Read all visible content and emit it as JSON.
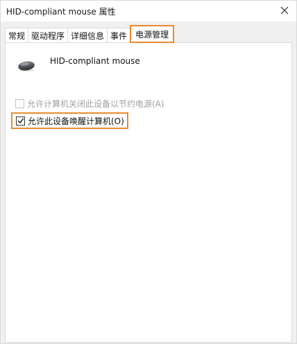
{
  "window": {
    "title": "HID-compliant mouse 属性"
  },
  "tabs": [
    {
      "label": "常规"
    },
    {
      "label": "驱动程序"
    },
    {
      "label": "详细信息"
    },
    {
      "label": "事件"
    },
    {
      "label": "电源管理"
    }
  ],
  "active_tab": "电源管理",
  "device": {
    "name": "HID-compliant mouse",
    "icon": "mouse-icon"
  },
  "options": {
    "allow_turn_off": {
      "label": "允许计算机关闭此设备以节约电源(A)",
      "checked": false,
      "enabled": false
    },
    "allow_wake": {
      "label": "允许此设备唤醒计算机(O)",
      "checked": true,
      "enabled": true
    }
  },
  "colors": {
    "highlight": "#e98a2e",
    "disabled_text": "#a0a0a0"
  }
}
